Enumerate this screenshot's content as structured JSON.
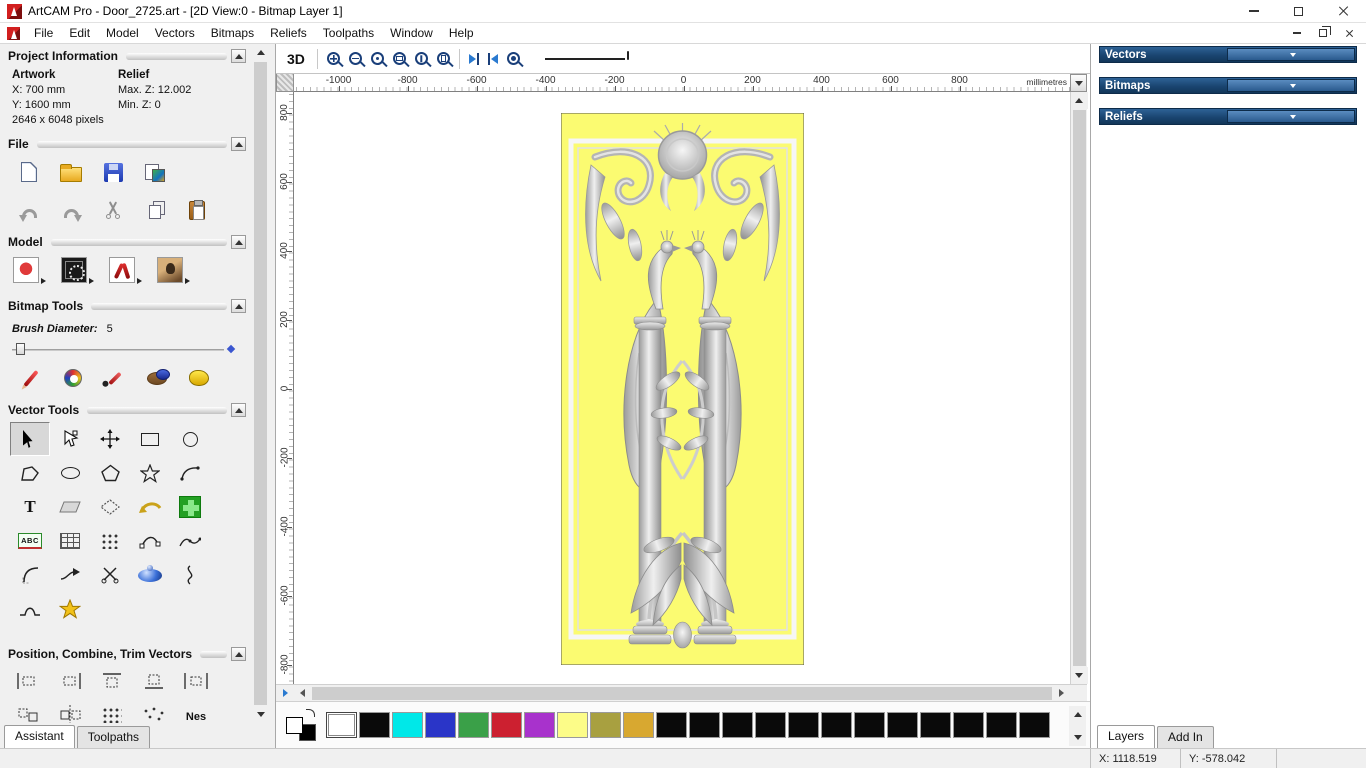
{
  "window": {
    "title": "ArtCAM Pro - Door_2725.art - [2D View:0 - Bitmap Layer 1]"
  },
  "menu": {
    "items": [
      "File",
      "Edit",
      "Model",
      "Vectors",
      "Bitmaps",
      "Reliefs",
      "Toolpaths",
      "Window",
      "Help"
    ]
  },
  "assistant": {
    "project_info": {
      "title": "Project Information",
      "artwork_label": "Artwork",
      "x": "X: 700 mm",
      "y": "Y: 1600 mm",
      "pixels": "2646 x 6048 pixels",
      "relief_label": "Relief",
      "max_z": "Max. Z: 12.002",
      "min_z": "Min. Z: 0"
    },
    "file_title": "File",
    "model_title": "Model",
    "bitmap_title": "Bitmap Tools",
    "brush_label": "Brush Diameter:",
    "brush_value": "5",
    "vector_title": "Vector Tools",
    "position_title": "Position, Combine, Trim Vectors",
    "text_glyph": "T",
    "abc_glyph": "ABC",
    "nes_glyph": "Nes",
    "tabs": [
      "Assistant",
      "Toolpaths"
    ]
  },
  "toolbar": {
    "btn_3d": "3D"
  },
  "rulers": {
    "horizontal": [
      "-1000",
      "-800",
      "-600",
      "-400",
      "-200",
      "0",
      "200",
      "400",
      "600",
      "800"
    ],
    "vertical": [
      "800",
      "600",
      "400",
      "200",
      "0",
      "-200",
      "-400",
      "-600",
      "-800"
    ],
    "units": "millimetres"
  },
  "palette": {
    "primary": "#ffffff",
    "secondary": "#000000",
    "colors": [
      "#ffffff",
      "#0a0a0a",
      "#00e8e8",
      "#2a35c8",
      "#3aa048",
      "#cc2030",
      "#a832cc",
      "#fcfc88",
      "#a8a040",
      "#d8a830",
      "#0a0a0a",
      "#0a0a0a",
      "#0a0a0a",
      "#0a0a0a",
      "#0a0a0a",
      "#0a0a0a",
      "#0a0a0a",
      "#0a0a0a",
      "#0a0a0a",
      "#0a0a0a",
      "#0a0a0a",
      "#0a0a0a"
    ]
  },
  "right_panel": {
    "headers": [
      "Vectors",
      "Bitmaps",
      "Reliefs"
    ],
    "tabs": [
      "Layers",
      "Add In"
    ]
  },
  "statusbar": {
    "x": "X: 1118.519",
    "y": "Y: -578.042"
  }
}
